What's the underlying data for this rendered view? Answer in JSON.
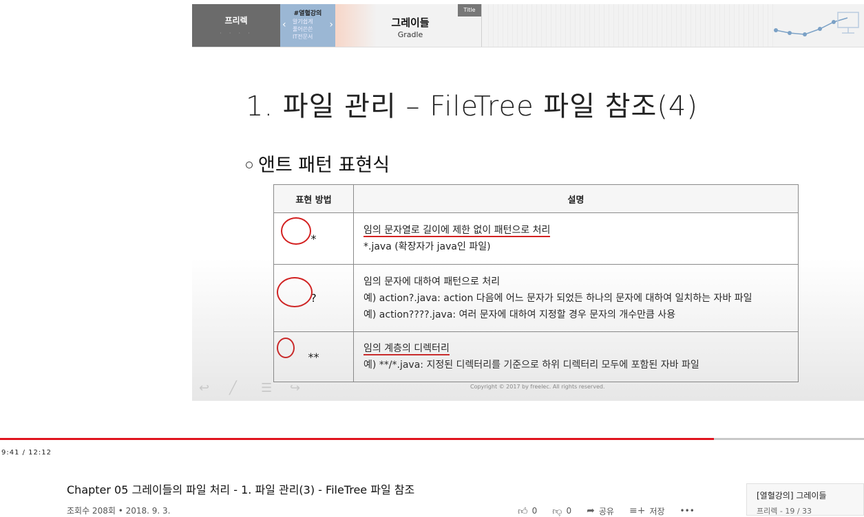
{
  "slide": {
    "header": {
      "brand": "프리렉",
      "promo_tag": "#열혈강의",
      "promo_lines": [
        "알기쉽게",
        "풀어쓴쓴",
        "IT전문서"
      ],
      "course_ko": "그레이들",
      "course_en": "Gradle",
      "title_tag": "Title"
    },
    "title": "1. 파일 관리 – FileTree 파일 참조(4)",
    "bullet": "앤트 패턴 표현식",
    "table": {
      "headers": [
        "표현 방법",
        "설명"
      ],
      "rows": [
        {
          "symbol": "*",
          "lines": [
            "임의 문자열로 길이에 제한 없이 패턴으로 처리",
            "*.java (확장자가 java인 파일)"
          ]
        },
        {
          "symbol": "?",
          "lines": [
            "임의 문자에 대하여 패턴으로 처리",
            "예) action?.java: action 다음에 어느 문자가 되었든 하나의 문자에 대하여 일치하는 자바 파일",
            "예) action????.java: 여러 문자에 대하여 지정할 경우 문자의 개수만큼 사용"
          ]
        },
        {
          "symbol": "**",
          "lines": [
            "임의 계층의 디렉터리",
            "예) **/*.java: 지정된 디렉터리를 기준으로 하위 디렉터리 모두에 포함된 자바 파일"
          ]
        }
      ]
    },
    "copyright": "Copyright © 2017 by freelec. All rights reserved."
  },
  "player": {
    "timecode": "9:41 / 12:12",
    "progress": 0.826
  },
  "video": {
    "title": "Chapter 05 그레이들의 파일 처리 - 1. 파일 관리(3) - FileTree 파일 참조",
    "meta": "조회수 208회 • 2018. 9. 3.",
    "likes": "0",
    "dislikes": "0",
    "share_label": "공유",
    "save_label": "저장",
    "more_label": "•••"
  },
  "playlist": {
    "title": "[열혈강의] 그레이들",
    "subtitle": "프리렉 - 19 / 33"
  },
  "colors": {
    "accent": "#e0141e",
    "annotation": "#d32020",
    "header_tab": "#6b6b6b"
  },
  "icons": [
    "like-icon",
    "dislike-icon",
    "share-icon",
    "save-icon",
    "more-icon",
    "nav-prev-icon",
    "nav-pen-icon",
    "nav-menu-icon",
    "nav-next-icon"
  ]
}
